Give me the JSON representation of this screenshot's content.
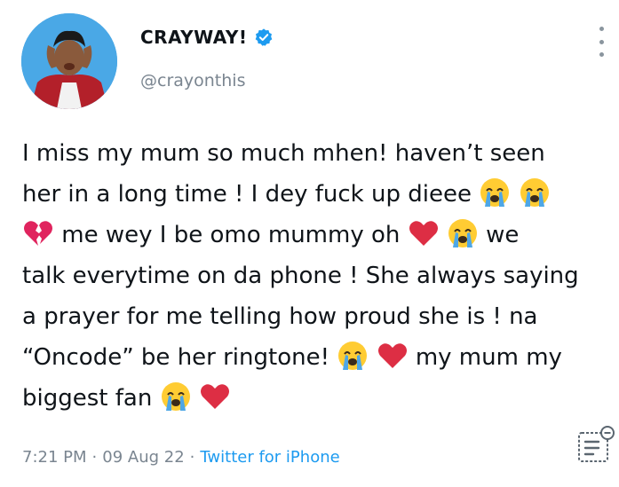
{
  "user": {
    "display_name": "CRAYWAY!",
    "handle": "@crayonthis",
    "verified": true,
    "verified_color": "#1d9bf0"
  },
  "tweet": {
    "segments": [
      {
        "text": "I miss my mum so much mhen! haven’t seen"
      },
      {
        "text": "her in a long time ! I dey fuck up dieee"
      },
      {
        "text": "me wey I be omo mummy oh"
      },
      {
        "text": "we"
      },
      {
        "text": "talk everytime on da phone ! She always saying"
      },
      {
        "text": "a prayer for me telling how proud she is ! na"
      },
      {
        "text": "“Oncode” be her ringtone!"
      },
      {
        "text": "my mum my"
      },
      {
        "text": "biggest fan"
      }
    ],
    "emojis": [
      "loudly-crying-face",
      "broken-heart",
      "red-heart"
    ]
  },
  "meta": {
    "time": "7:21 PM",
    "date": "09 Aug 22",
    "separator": "·",
    "source": "Twitter for iPhone"
  },
  "colors": {
    "text": "#0f1419",
    "secondary": "#7a8590",
    "link": "#1d9bf0"
  }
}
